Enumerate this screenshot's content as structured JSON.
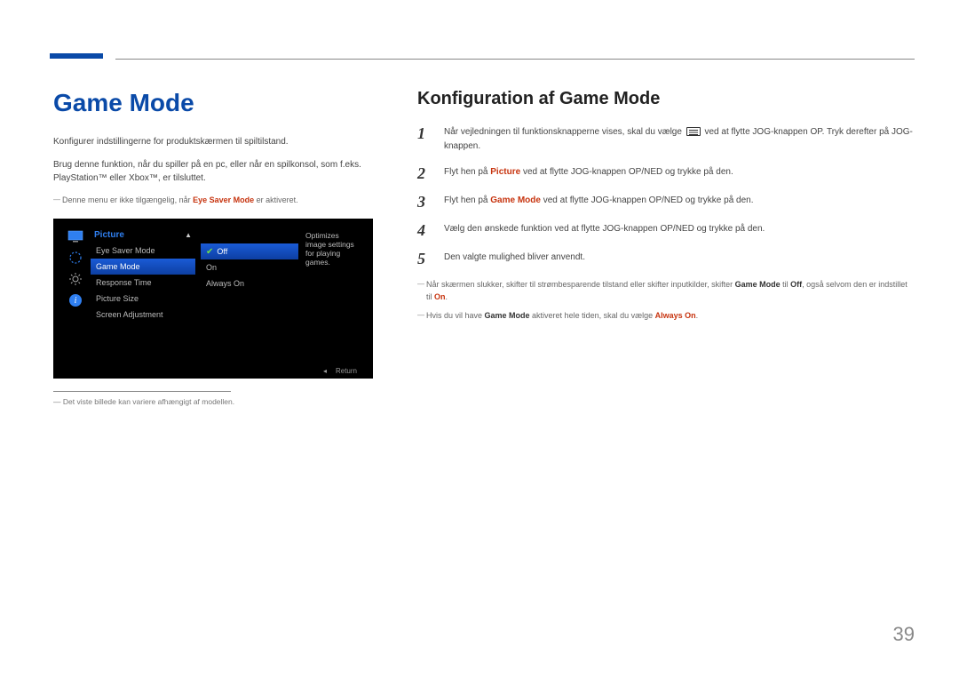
{
  "page_number": "39",
  "left": {
    "title": "Game Mode",
    "p1": "Konfigurer indstillingerne for produktskærmen til spiltilstand.",
    "p2": "Brug denne funktion, når du spiller på en pc, eller når en spilkonsol, som f.eks. PlayStation™ eller Xbox™, er tilsluttet.",
    "note1_pre": "Denne menu er ikke tilgængelig, når ",
    "note1_em": "Eye Saver Mode",
    "note1_post": " er aktiveret.",
    "footnote": "Det viste billede kan variere afhængigt af modellen."
  },
  "osd": {
    "menu_title": "Picture",
    "items": [
      "Eye Saver Mode",
      "Game Mode",
      "Response Time",
      "Picture Size",
      "Screen Adjustment"
    ],
    "options": [
      "Off",
      "On",
      "Always On"
    ],
    "selected_item": "Game Mode",
    "selected_option": "Off",
    "description": "Optimizes image settings for playing games.",
    "return_label": "Return"
  },
  "right": {
    "title": "Konfiguration af Game Mode",
    "steps": {
      "s1_pre": "Når vejledningen til funktionsknapperne vises, skal du vælge ",
      "s1_post": " ved at flytte JOG-knappen OP. Tryk derefter på JOG-knappen.",
      "s2_pre": "Flyt hen på ",
      "s2_em": "Picture",
      "s2_post": " ved at flytte JOG-knappen OP/NED og trykke på den.",
      "s3_pre": "Flyt hen på ",
      "s3_em": "Game Mode",
      "s3_post": " ved at flytte JOG-knappen OP/NED og trykke på den.",
      "s4": "Vælg den ønskede funktion ved at flytte JOG-knappen OP/NED og trykke på den.",
      "s5": "Den valgte mulighed bliver anvendt."
    },
    "note2_pre": "Når skærmen slukker, skifter til strømbesparende tilstand eller skifter inputkilder, skifter ",
    "note2_em1": "Game Mode",
    "note2_mid": " til ",
    "note2_em2": "Off",
    "note2_mid2": ", også selvom den er indstillet til ",
    "note2_em3": "On",
    "note2_end": ".",
    "note3_pre": "Hvis du vil have ",
    "note3_em1": "Game Mode",
    "note3_mid": " aktiveret hele tiden, skal du vælge ",
    "note3_em2": "Always On",
    "note3_end": "."
  }
}
